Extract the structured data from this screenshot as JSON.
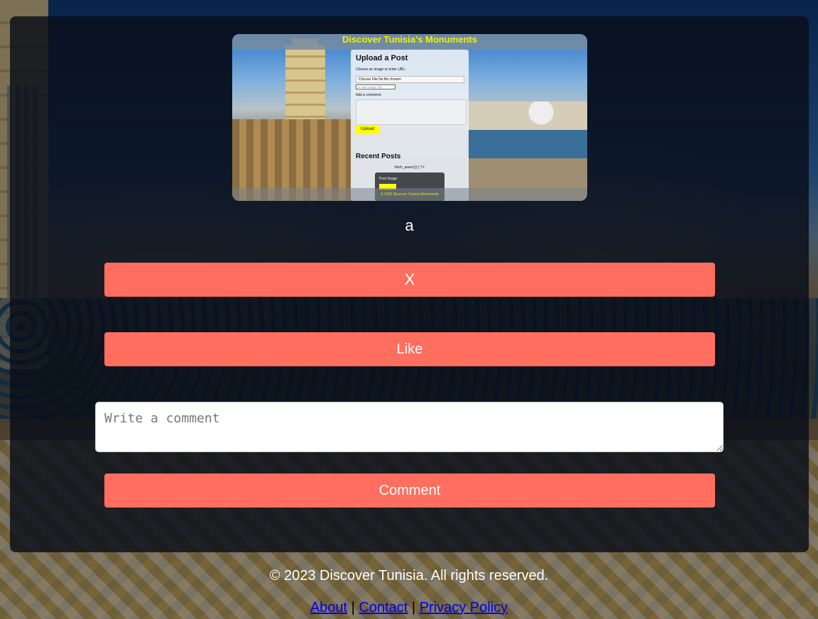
{
  "post": {
    "thumbnail": {
      "site_title": "Discover Tunisia's Monuments",
      "upload_title": "Upload a Post",
      "choose_label": "Choose an image or enter URL:",
      "file_button": "Choose File",
      "file_status": "No file chosen",
      "url_placeholder": "or enter image URL",
      "comment_label": "Add a comment:",
      "upload_button": "Upload",
      "recent_title": "Recent Posts",
      "code_text": "fetch_assoc()) { ?>",
      "post_image_alt": "Post Image",
      "footer_text": "© 2023 Discover Tunisia Monuments"
    },
    "caption": "a",
    "delete_label": "X",
    "like_label": "Like",
    "comment_placeholder": "Write a comment",
    "comment_label": "Comment"
  },
  "footer": {
    "copyright": "© 2023 Discover Tunisia. All rights reserved.",
    "links": [
      "About",
      "Contact",
      "Privacy Policy"
    ],
    "separator": "|"
  },
  "colors": {
    "button": "#ff6e5e",
    "link": "#0000ee",
    "site_title": "#f2ef00"
  }
}
